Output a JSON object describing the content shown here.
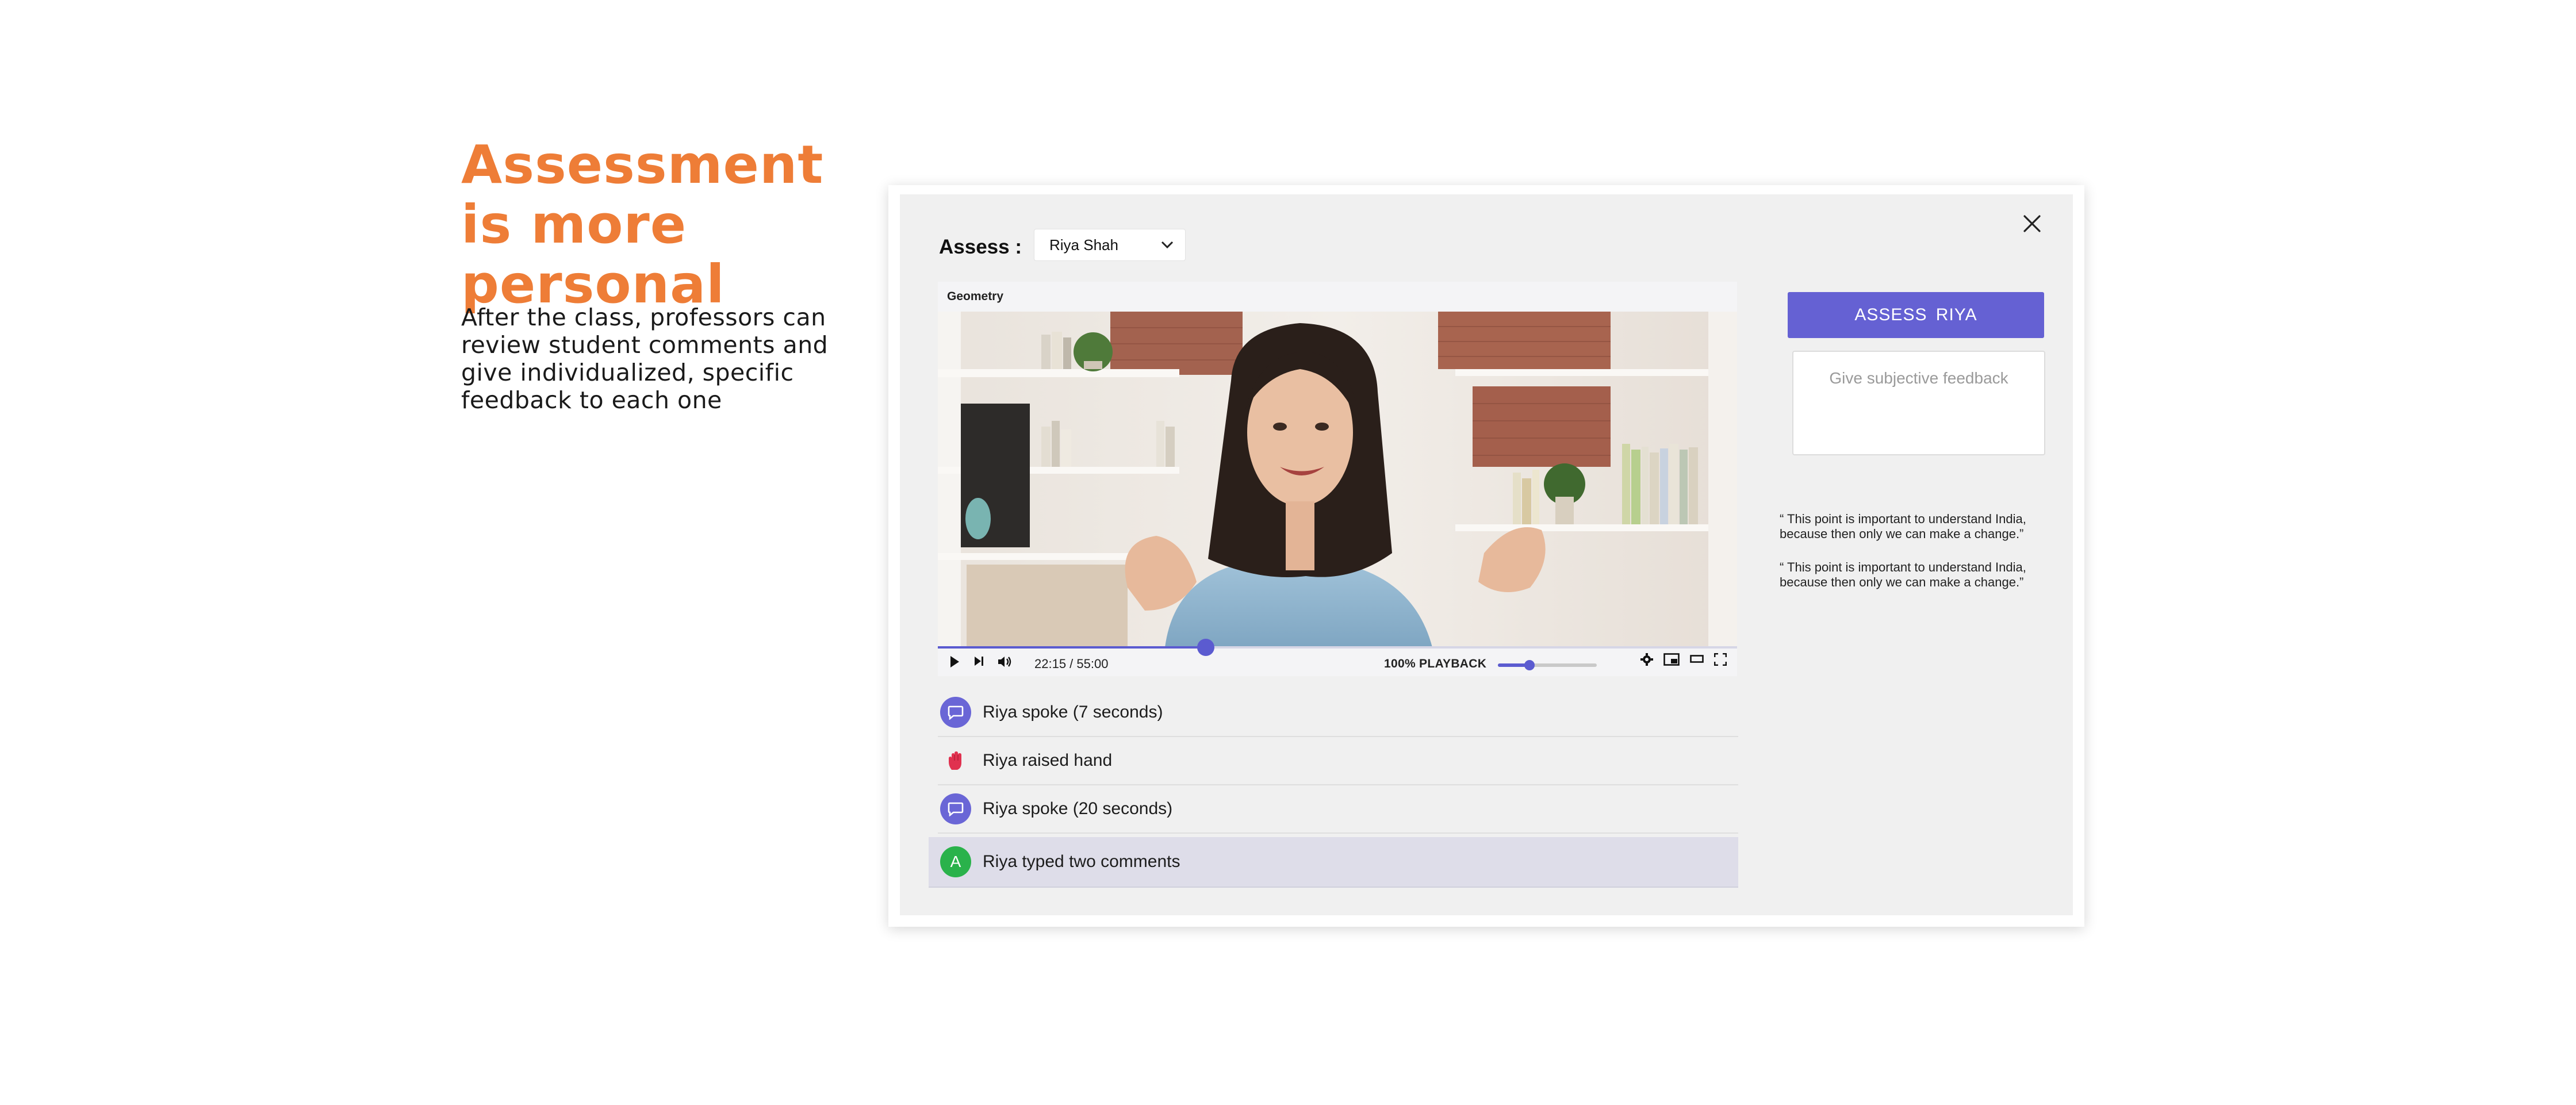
{
  "slide": {
    "headline": "Assessment is more personal",
    "description": "After the class, professors can review student comments and give individualized, specific feedback to each one"
  },
  "modal": {
    "assess_label": "Assess :",
    "student_select": {
      "selected": "Riya Shah"
    },
    "assess_button": "ASSESS  RIYA",
    "feedback_placeholder": "Give subjective feedback",
    "quotes": [
      "“ This point is important to understand India, because then only we can make a change.”",
      "“ This point is important to understand India, because then only we can make a change.”"
    ]
  },
  "video": {
    "title": "Geometry",
    "time": "22:15 / 55:00",
    "playback": "100% PLAYBACK",
    "progress": 0.335,
    "speed_level": 0.32
  },
  "events": [
    {
      "icon": "speech-bubble-icon",
      "label": "Riya spoke (7 seconds)"
    },
    {
      "icon": "raised-hand-icon",
      "label": "Riya raised hand"
    },
    {
      "icon": "speech-bubble-icon",
      "label": "Riya spoke (20 seconds)"
    },
    {
      "icon": "typed-comment-icon",
      "icon_letter": "A",
      "label": "Riya typed two comments",
      "selected": true
    }
  ],
  "colors": {
    "headline": "#ee7d37",
    "accent": "#6561d3",
    "typed_icon": "#2ab24b",
    "selected_row": "#dedde9"
  }
}
